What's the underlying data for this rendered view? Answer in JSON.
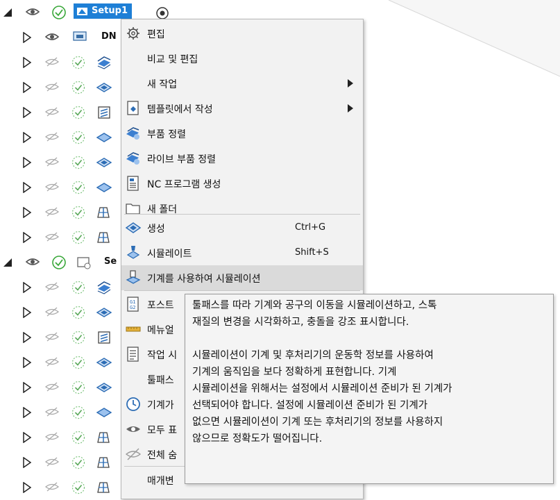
{
  "tree": {
    "setup1_label": "Setup1",
    "dn_label": "DN",
    "setup2_label": "Se"
  },
  "menu": {
    "items": [
      {
        "label": "편집",
        "icon": "gear-icon"
      },
      {
        "label": "비교 및 편집"
      },
      {
        "label": "새 작업",
        "submenu": true
      },
      {
        "label": "템플릿에서 작성",
        "icon": "template-icon",
        "submenu": true
      },
      {
        "label": "부품 정렬",
        "icon": "part-align-icon"
      },
      {
        "label": "라이브 부품 정렬",
        "icon": "live-part-align-icon"
      },
      {
        "label": "NC 프로그램 생성",
        "icon": "nc-program-icon"
      },
      {
        "label": "새 폴더",
        "icon": "folder-icon"
      },
      {
        "label": "생성",
        "icon": "generate-icon",
        "shortcut": "Ctrl+G"
      },
      {
        "label": "시뮬레이트",
        "icon": "simulate-icon",
        "shortcut": "Shift+S"
      },
      {
        "label": "기계를 사용하여 시뮬레이션",
        "icon": "machine-simulate-icon"
      },
      {
        "label": "포스트",
        "icon": "post-icon"
      },
      {
        "label": "메뉴얼",
        "icon": "manual-icon"
      },
      {
        "label": "작업 시",
        "icon": "setup-sheet-icon"
      },
      {
        "label": "툴패스"
      },
      {
        "label": "기계가",
        "icon": "clock-icon"
      },
      {
        "label": "모두 표",
        "icon": "eye-icon"
      },
      {
        "label": "전체 숨",
        "icon": "eye-hidden-icon"
      },
      {
        "label": "매개변"
      }
    ]
  },
  "tooltip": {
    "lines": [
      "툴패스를 따라 기계와 공구의 이동을 시뮬레이션하고, 스톡",
      "재질의 변경을 시각화하고, 충돌을 강조 표시합니다.",
      "시뮬레이션이 기계 및 후처리기의 운동학 정보를 사용하여",
      "기계의 움직임을 보다 정확하게 표현합니다. 기계",
      "시뮬레이션을 위해서는 설정에서 시뮬레이션 준비가 된 기계가",
      "선택되어야 합니다. 설정에 시뮬레이션 준비가 된 기계가",
      "없으면 시뮬레이션이 기계 또는 후처리기의 정보를 사용하지",
      "않으므로 정확도가 떨어집니다."
    ]
  },
  "colors": {
    "selection": "#1e7fd6",
    "menu_bg": "#f2f2f2",
    "highlight": "#dadada",
    "check_green": "#3aa83a"
  }
}
